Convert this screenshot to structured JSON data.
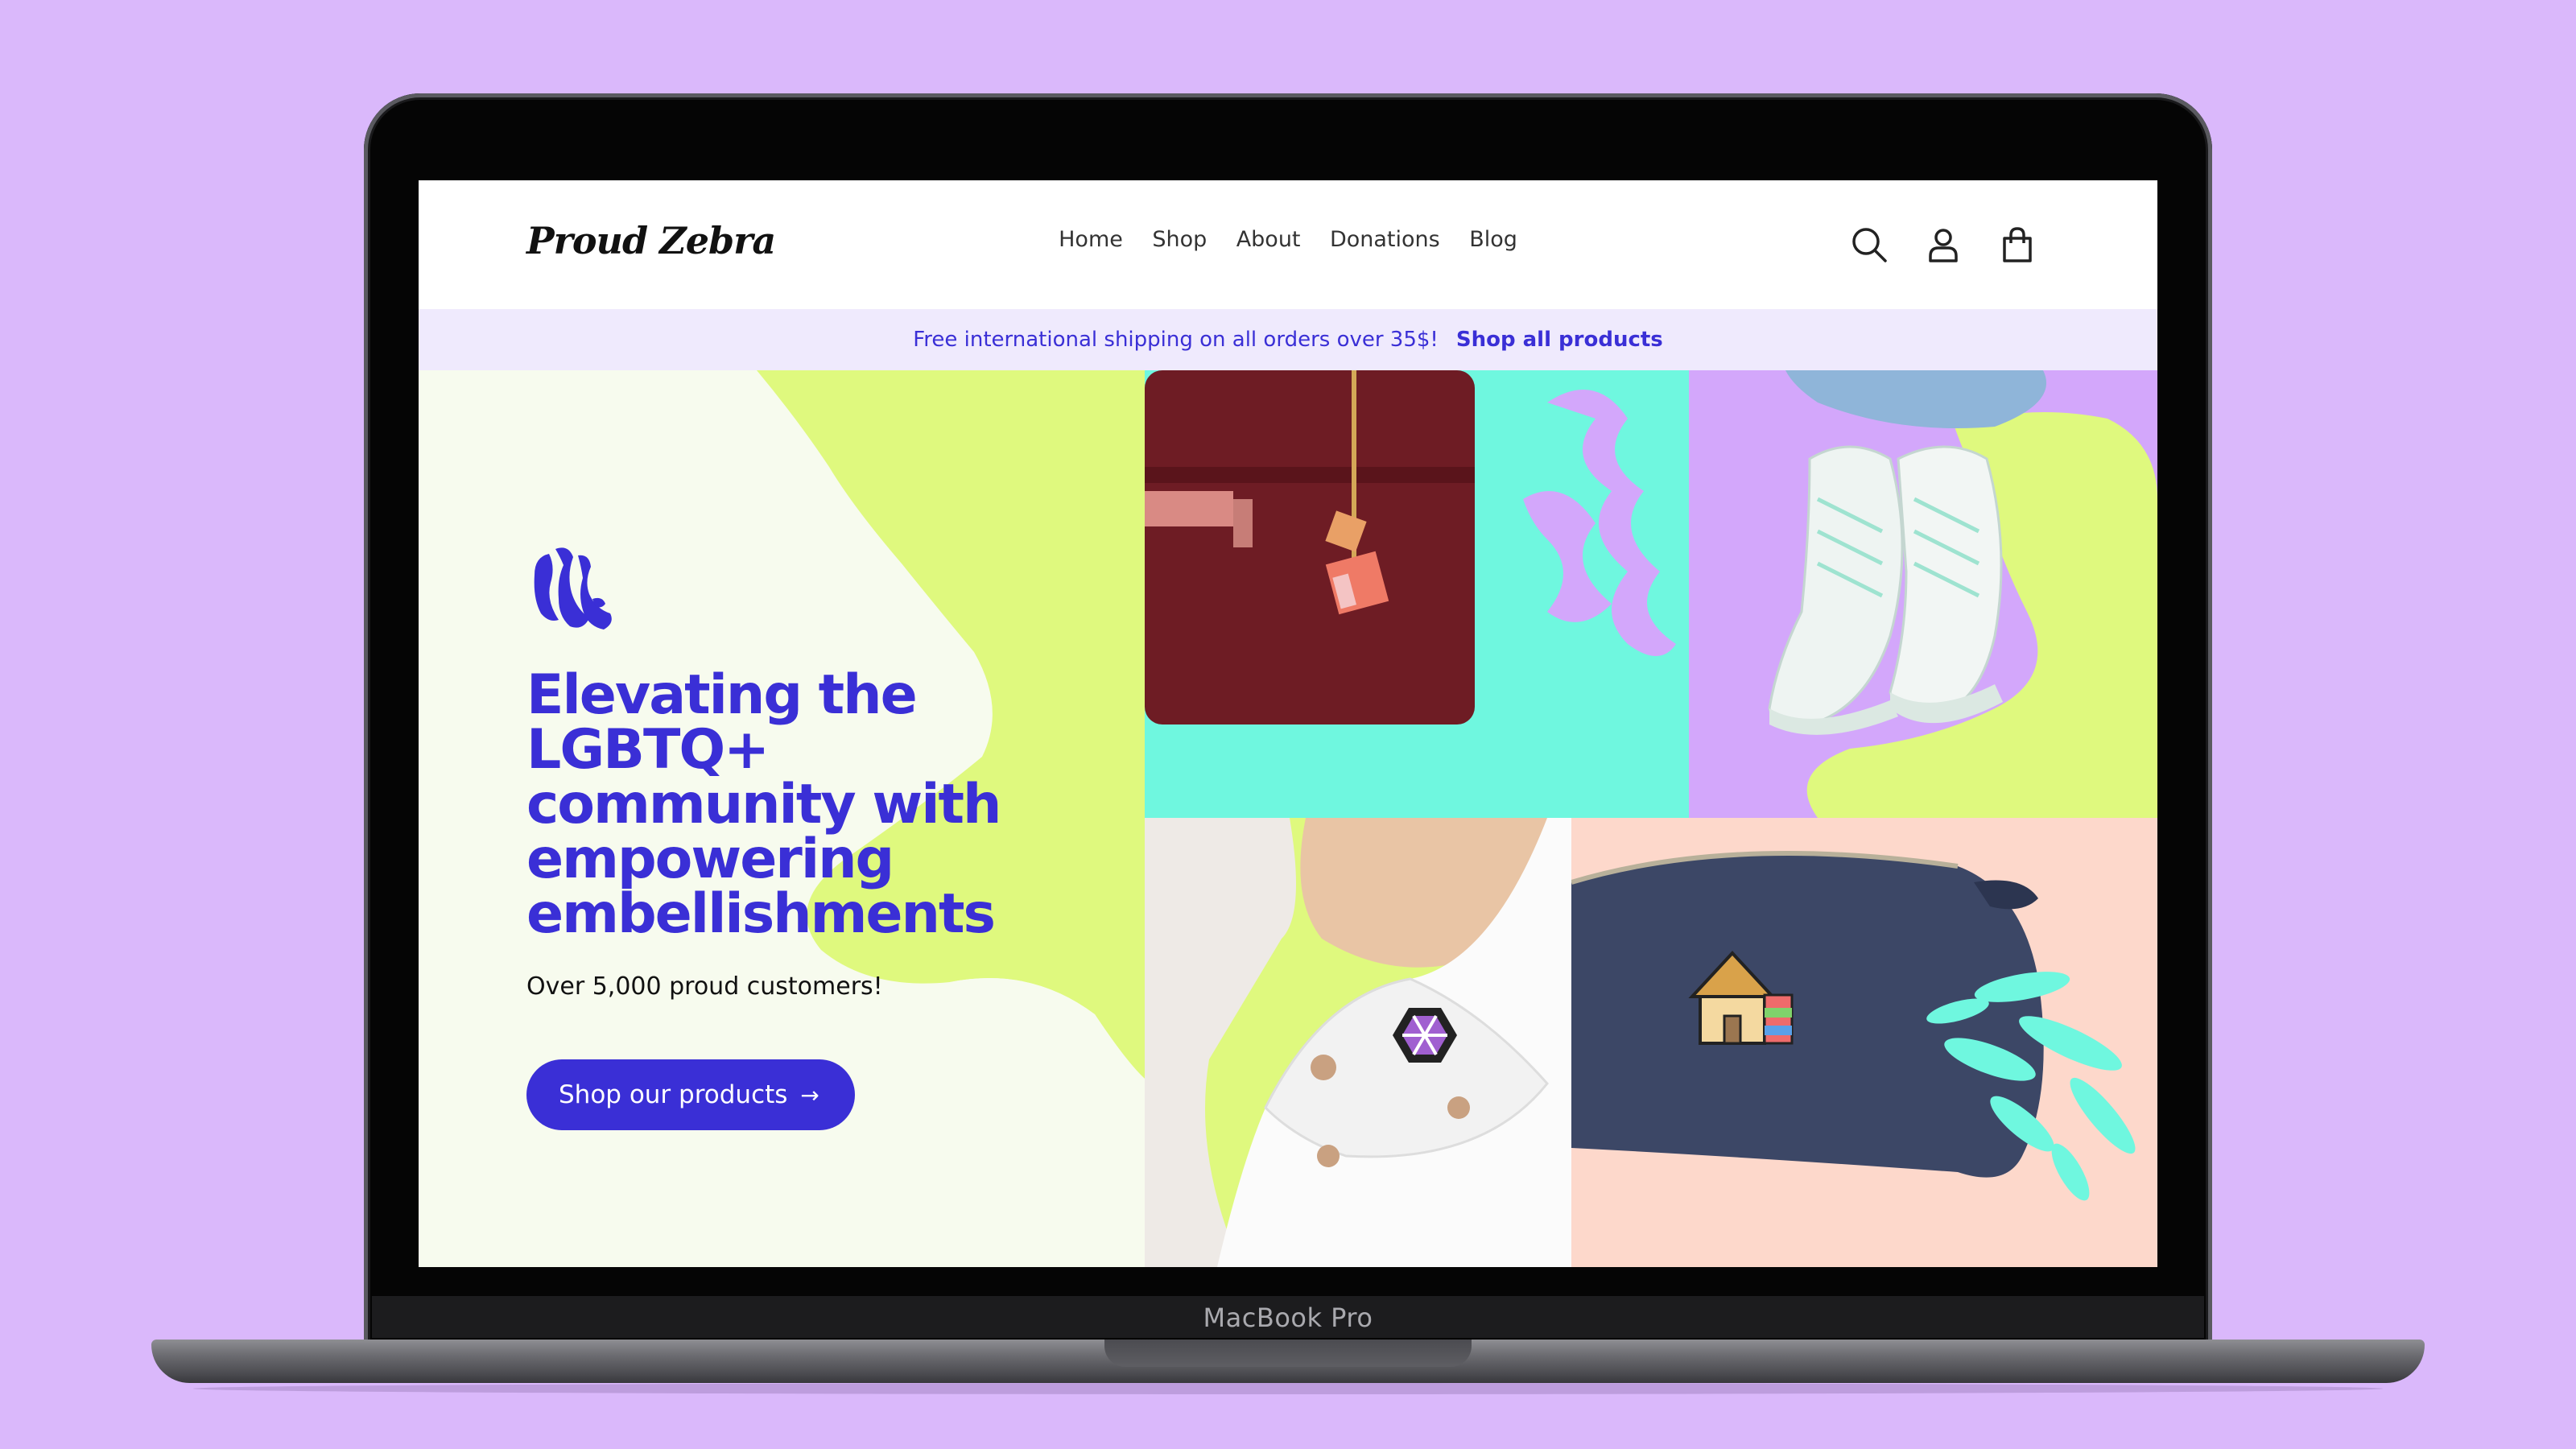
{
  "device": {
    "model_label": "MacBook Pro"
  },
  "site": {
    "logo_text": "Proud Zebra",
    "nav": [
      "Home",
      "Shop",
      "About",
      "Donations",
      "Blog"
    ],
    "header_icons": [
      "search-icon",
      "account-icon",
      "cart-icon"
    ]
  },
  "announcement": {
    "text": "Free international shipping on all orders over 35$!",
    "link": "Shop all products"
  },
  "hero": {
    "headline": "Elevating the LGBTQ+ community with empowering embellishments",
    "subtitle": "Over 5,000 proud customers!",
    "cta_label": "Shop our products",
    "cta_icon": "arrow-right-icon"
  },
  "colors": {
    "accent": "#3a2fd6",
    "background": "#dab8fb",
    "lime": "#dff97e",
    "mint": "#6ff7df",
    "lavender": "#d3a7fb",
    "peach": "#fdd8cb",
    "cream": "#f7fbee"
  }
}
